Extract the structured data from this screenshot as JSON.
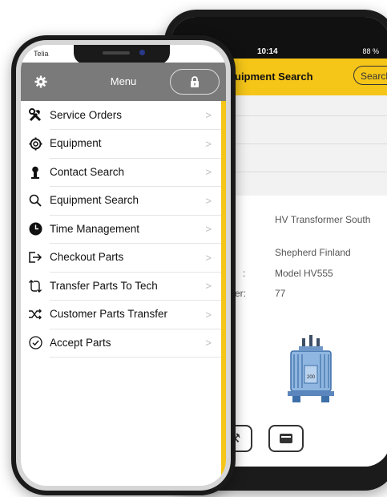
{
  "back_screen": {
    "status_time": "10:14",
    "battery": "88 %",
    "header_title": "uipment Search",
    "search_button": "Search",
    "details": {
      "name_value": "HV Transformer South",
      "company_value": "Shepherd Finland",
      "model_label": ":",
      "model_value": "Model HV555",
      "number_label": "er:",
      "number_value": "77"
    },
    "image_text": "200"
  },
  "front_screen": {
    "carrier": "Telia",
    "menu_title": "Menu",
    "menu_items": [
      {
        "label": "Service Orders",
        "icon": "tools-icon"
      },
      {
        "label": "Equipment",
        "icon": "gear-outline-icon"
      },
      {
        "label": "Contact Search",
        "icon": "person-icon"
      },
      {
        "label": "Equipment Search",
        "icon": "search-icon"
      },
      {
        "label": "Time Management",
        "icon": "clock-icon"
      },
      {
        "label": "Checkout Parts",
        "icon": "checkout-icon"
      },
      {
        "label": "Transfer Parts To Tech",
        "icon": "transfer-icon"
      },
      {
        "label": "Customer Parts Transfer",
        "icon": "shuffle-icon"
      },
      {
        "label": "Accept Parts",
        "icon": "check-circle-icon"
      }
    ],
    "chevron": ">"
  },
  "colors": {
    "accent": "#f5c518",
    "menu_header": "#7a7a7a"
  }
}
